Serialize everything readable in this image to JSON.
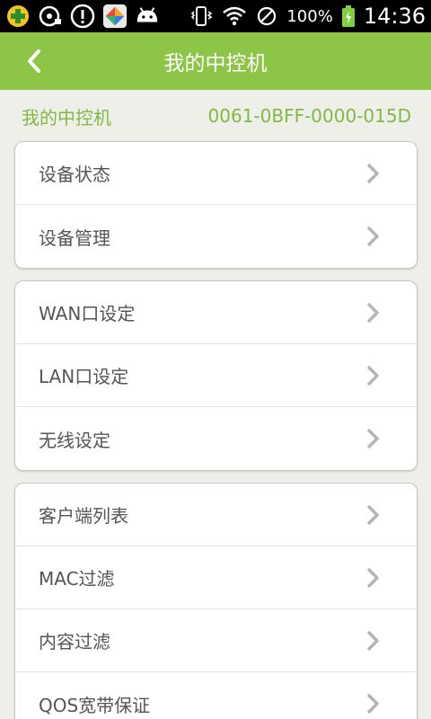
{
  "statusbar": {
    "battery_percent": "100%",
    "time": "14:36"
  },
  "header": {
    "title": "我的中控机"
  },
  "device": {
    "label": "我的中控机",
    "id": "0061-0BFF-0000-015D"
  },
  "groups": [
    {
      "items": [
        {
          "label": "设备状态"
        },
        {
          "label": "设备管理"
        }
      ]
    },
    {
      "items": [
        {
          "label": "WAN口设定"
        },
        {
          "label": "LAN口设定"
        },
        {
          "label": "无线设定"
        }
      ]
    },
    {
      "items": [
        {
          "label": "客户端列表"
        },
        {
          "label": "MAC过滤"
        },
        {
          "label": "内容过滤"
        },
        {
          "label": "QOS宽带保证"
        }
      ]
    }
  ],
  "colors": {
    "accent": "#8dc546",
    "device_text": "#82b844",
    "background": "#efefea"
  }
}
